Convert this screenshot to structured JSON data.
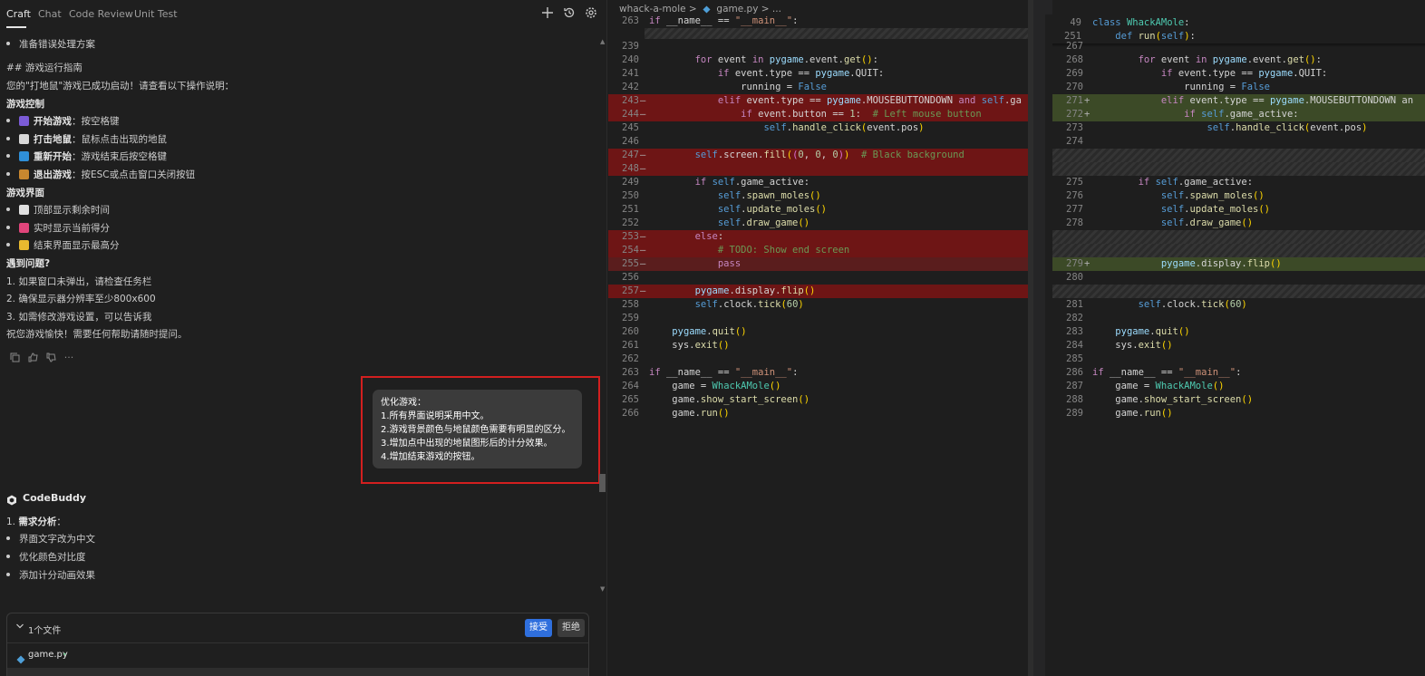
{
  "chat": {
    "tabs": [
      "Craft",
      "Chat",
      "Code Review",
      "Unit Test"
    ],
    "header_icons": [
      "plus-icon",
      "history-icon",
      "settings-icon"
    ],
    "lines": [
      {
        "type": "bullet",
        "text": "准备错误处理方案"
      },
      {
        "type": "text",
        "text": "## 游戏运行指南"
      },
      {
        "type": "text",
        "text": "您的\"打地鼠\"游戏已成功启动！请查看以下操作说明："
      },
      {
        "type": "heading",
        "text": "游戏控制"
      },
      {
        "type": "bullet-emoji",
        "emoji": "joystick-icon",
        "color": "#7b5bd6",
        "bold": "开始游戏",
        "text": "：按空格键"
      },
      {
        "type": "bullet-emoji",
        "emoji": "mouse-icon",
        "color": "#d8d8d8",
        "bold": "打击地鼠",
        "text": "：鼠标点击出现的地鼠"
      },
      {
        "type": "bullet-emoji",
        "emoji": "restart-icon",
        "color": "#2f8fd8",
        "bold": "重新开始",
        "text": "：游戏结束后按空格键"
      },
      {
        "type": "bullet-emoji",
        "emoji": "door-icon",
        "color": "#c8872f",
        "bold": "退出游戏",
        "text": "：按ESC或点击窗口关闭按钮"
      },
      {
        "type": "heading",
        "text": "游戏界面"
      },
      {
        "type": "bullet-emoji",
        "emoji": "stopwatch-icon",
        "color": "#e0e0e0",
        "bold": "",
        "text": "顶部显示剩余时间"
      },
      {
        "type": "bullet-emoji",
        "emoji": "score-icon",
        "color": "#e0457b",
        "bold": "",
        "text": "实时显示当前得分"
      },
      {
        "type": "bullet-emoji",
        "emoji": "trophy-icon",
        "color": "#e8b92f",
        "bold": "",
        "text": "结束界面显示最高分"
      },
      {
        "type": "heading",
        "text": "遇到问题?"
      },
      {
        "type": "text",
        "text": "1. 如果窗口未弹出，请检查任务栏"
      },
      {
        "type": "text",
        "text": "2. 确保显示器分辨率至少800x600"
      },
      {
        "type": "text",
        "text": "3. 如需修改游戏设置，可以告诉我"
      },
      {
        "type": "text",
        "text": "祝您游戏愉快！需要任何帮助请随时提问。"
      }
    ],
    "message_actions": [
      "copy-icon",
      "thumbs-up-icon",
      "thumbs-down-icon",
      "more-icon"
    ],
    "user_message": [
      "优化游戏：",
      "1.所有界面说明采用中文。",
      "2.游戏背景颜色与地鼠颜色需要有明显的区分。",
      "3.增加点中出现的地鼠图形后的计分效果。",
      "4.增加结束游戏的按钮。"
    ],
    "assistant_name": "CodeBuddy",
    "reply": [
      {
        "type": "text",
        "prefix": "1. ",
        "bold": "需求分析",
        "text": "："
      },
      {
        "type": "bullet",
        "text": "界面文字改为中文"
      },
      {
        "type": "bullet",
        "text": "优化颜色对比度"
      },
      {
        "type": "bullet",
        "text": "添加计分动画效果"
      }
    ],
    "files_panel": {
      "count_label": "1个文件",
      "accept_label": "接受",
      "reject_label": "拒绝",
      "file_name": "game.py",
      "file_status": "•"
    }
  },
  "editor_left": {
    "breadcrumb": {
      "folder": "whack-a-mole",
      "sep": ">",
      "file": "game.py",
      "tail": "> ..."
    },
    "sticky": {
      "ln": "263",
      "code": "if __name__ == \"__main__\":"
    },
    "lines": [
      {
        "ln": "239",
        "mk": "",
        "bg": "",
        "code": ""
      },
      {
        "ln": "240",
        "mk": "",
        "bg": "",
        "code": "        for event in pygame.event.get():"
      },
      {
        "ln": "241",
        "mk": "",
        "bg": "",
        "code": "            if event.type == pygame.QUIT:"
      },
      {
        "ln": "242",
        "mk": "",
        "bg": "",
        "code": "                running = False"
      },
      {
        "ln": "243",
        "mk": "—",
        "bg": "del",
        "code": "            elif event.type == pygame.MOUSEBUTTONDOWN and self.ga"
      },
      {
        "ln": "244",
        "mk": "—",
        "bg": "del",
        "code": "                if event.button == 1:  # Left mouse button"
      },
      {
        "ln": "245",
        "mk": "",
        "bg": "",
        "code": "                    self.handle_click(event.pos)"
      },
      {
        "ln": "246",
        "mk": "",
        "bg": "",
        "code": ""
      },
      {
        "ln": "247",
        "mk": "—",
        "bg": "del",
        "code": "        self.screen.fill((0, 0, 0))  # Black background"
      },
      {
        "ln": "248",
        "mk": "—",
        "bg": "del",
        "code": ""
      },
      {
        "ln": "249",
        "mk": "",
        "bg": "",
        "code": "        if self.game_active:"
      },
      {
        "ln": "250",
        "mk": "",
        "bg": "",
        "code": "            self.spawn_moles()"
      },
      {
        "ln": "251",
        "mk": "",
        "bg": "",
        "code": "            self.update_moles()"
      },
      {
        "ln": "252",
        "mk": "",
        "bg": "",
        "code": "            self.draw_game()"
      },
      {
        "ln": "253",
        "mk": "—",
        "bg": "del",
        "code": "        else:"
      },
      {
        "ln": "254",
        "mk": "—",
        "bg": "del",
        "code": "            # TODO: Show end screen"
      },
      {
        "ln": "255",
        "mk": "—",
        "bg": "del2",
        "code": "            pass"
      },
      {
        "ln": "256",
        "mk": "",
        "bg": "",
        "code": ""
      },
      {
        "ln": "257",
        "mk": "—",
        "bg": "del",
        "code": "        pygame.display.flip()"
      },
      {
        "ln": "258",
        "mk": "",
        "bg": "",
        "code": "        self.clock.tick(60)"
      },
      {
        "ln": "259",
        "mk": "",
        "bg": "",
        "code": ""
      },
      {
        "ln": "260",
        "mk": "",
        "bg": "",
        "code": "    pygame.quit()"
      },
      {
        "ln": "261",
        "mk": "",
        "bg": "",
        "code": "    sys.exit()"
      },
      {
        "ln": "262",
        "mk": "",
        "bg": "",
        "code": ""
      },
      {
        "ln": "263",
        "mk": "",
        "bg": "",
        "code": "if __name__ == \"__main__\":"
      },
      {
        "ln": "264",
        "mk": "",
        "bg": "",
        "code": "    game = WhackAMole()"
      },
      {
        "ln": "265",
        "mk": "",
        "bg": "",
        "code": "    game.show_start_screen()"
      },
      {
        "ln": "266",
        "mk": "",
        "bg": "",
        "code": "    game.run()"
      }
    ]
  },
  "editor_right": {
    "sticky": [
      {
        "ln": "49",
        "code": "class WhackAMole:"
      },
      {
        "ln": "251",
        "code": "    def run(self):"
      }
    ],
    "lines": [
      {
        "ln": "267",
        "mk": "",
        "bg": "",
        "code": ""
      },
      {
        "ln": "268",
        "mk": "",
        "bg": "",
        "code": "        for event in pygame.event.get():"
      },
      {
        "ln": "269",
        "mk": "",
        "bg": "",
        "code": "            if event.type == pygame.QUIT:"
      },
      {
        "ln": "270",
        "mk": "",
        "bg": "",
        "code": "                running = False"
      },
      {
        "ln": "271",
        "mk": "+",
        "bg": "add",
        "code": "            elif event.type == pygame.MOUSEBUTTONDOWN an"
      },
      {
        "ln": "272",
        "mk": "+",
        "bg": "add",
        "code": "                if self.game_active:"
      },
      {
        "ln": "273",
        "mk": "",
        "bg": "",
        "code": "                    self.handle_click(event.pos)"
      },
      {
        "ln": "274",
        "mk": "",
        "bg": "",
        "code": ""
      },
      {
        "ln": "",
        "mk": "",
        "bg": "hatch",
        "code": ""
      },
      {
        "ln": "",
        "mk": "",
        "bg": "hatch",
        "code": ""
      },
      {
        "ln": "275",
        "mk": "",
        "bg": "",
        "code": "        if self.game_active:"
      },
      {
        "ln": "276",
        "mk": "",
        "bg": "",
        "code": "            self.spawn_moles()"
      },
      {
        "ln": "277",
        "mk": "",
        "bg": "",
        "code": "            self.update_moles()"
      },
      {
        "ln": "278",
        "mk": "",
        "bg": "",
        "code": "            self.draw_game()"
      },
      {
        "ln": "",
        "mk": "",
        "bg": "hatch",
        "code": ""
      },
      {
        "ln": "",
        "mk": "",
        "bg": "hatch",
        "code": ""
      },
      {
        "ln": "279",
        "mk": "+",
        "bg": "add",
        "code": "            pygame.display.flip()"
      },
      {
        "ln": "280",
        "mk": "",
        "bg": "",
        "code": ""
      },
      {
        "ln": "",
        "mk": "",
        "bg": "hatch",
        "code": ""
      },
      {
        "ln": "281",
        "mk": "",
        "bg": "",
        "code": "        self.clock.tick(60)"
      },
      {
        "ln": "282",
        "mk": "",
        "bg": "",
        "code": ""
      },
      {
        "ln": "283",
        "mk": "",
        "bg": "",
        "code": "    pygame.quit()"
      },
      {
        "ln": "284",
        "mk": "",
        "bg": "",
        "code": "    sys.exit()"
      },
      {
        "ln": "285",
        "mk": "",
        "bg": "",
        "code": ""
      },
      {
        "ln": "286",
        "mk": "",
        "bg": "",
        "code": "if __name__ == \"__main__\":"
      },
      {
        "ln": "287",
        "mk": "",
        "bg": "",
        "code": "    game = WhackAMole()"
      },
      {
        "ln": "288",
        "mk": "",
        "bg": "",
        "code": "    game.show_start_screen()"
      },
      {
        "ln": "289",
        "mk": "",
        "bg": "",
        "code": "    game.run()"
      }
    ]
  },
  "colors": {
    "accent": "#2f6fdd",
    "highlight_box": "#d21f1f",
    "deleted_line": "#6e1515",
    "added_line": "#3c4a27"
  }
}
